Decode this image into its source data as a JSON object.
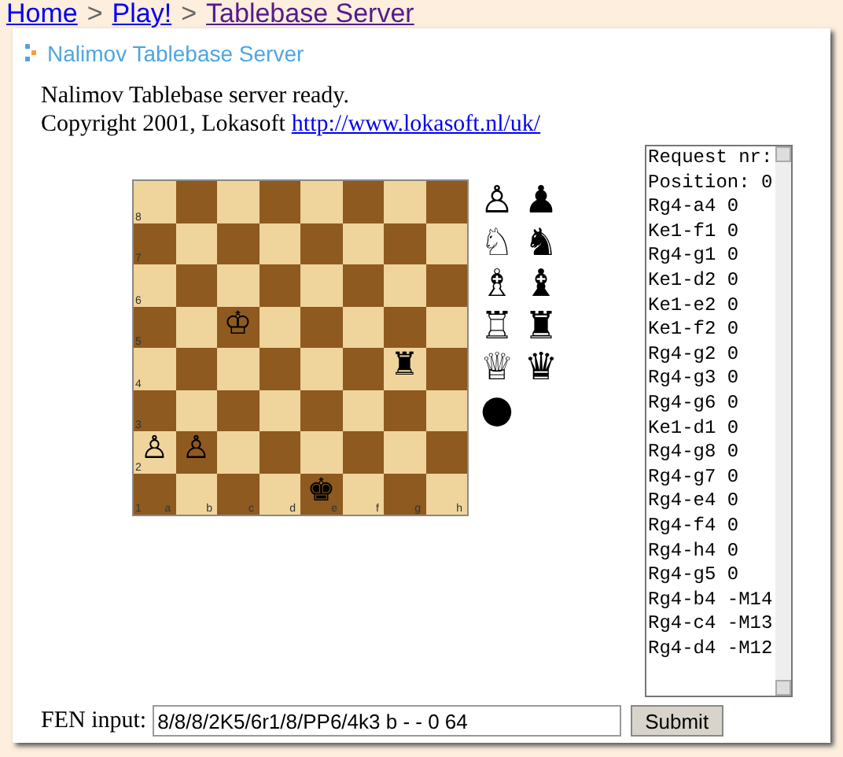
{
  "breadcrumb": [
    {
      "label": "Home",
      "visited": false
    },
    {
      "label": "Play!",
      "visited": false
    },
    {
      "label": "Tablebase Server",
      "visited": true
    }
  ],
  "breadcrumb_separator": ">",
  "heading": "Nalimov Tablebase Server",
  "status_text": "Nalimov Tablebase server ready.",
  "copyright": "Copyright 2001, Lokasoft",
  "link": "http://www.lokasoft.nl/uk/",
  "board": {
    "rank_labels": [
      "8",
      "7",
      "6",
      "5",
      "4",
      "3",
      "2",
      "1"
    ],
    "file_labels": [
      "a",
      "b",
      "c",
      "d",
      "e",
      "f",
      "g",
      "h"
    ],
    "rows": [
      [
        {
          "kind": "light"
        },
        {
          "kind": "dark"
        },
        {
          "kind": "light"
        },
        {
          "kind": "dark"
        },
        {
          "kind": "light"
        },
        {
          "kind": "dark"
        },
        {
          "kind": "light"
        },
        {
          "kind": "dark"
        }
      ],
      [
        {
          "kind": "dark"
        },
        {
          "kind": "light"
        },
        {
          "kind": "dark"
        },
        {
          "kind": "light"
        },
        {
          "kind": "dark"
        },
        {
          "kind": "light"
        },
        {
          "kind": "dark"
        },
        {
          "kind": "light"
        }
      ],
      [
        {
          "kind": "light"
        },
        {
          "kind": "dark"
        },
        {
          "kind": "light"
        },
        {
          "kind": "dark"
        },
        {
          "kind": "light"
        },
        {
          "kind": "dark"
        },
        {
          "kind": "light"
        },
        {
          "kind": "dark"
        }
      ],
      [
        {
          "kind": "dark"
        },
        {
          "kind": "light"
        },
        {
          "kind": "dark",
          "piece": "♔"
        },
        {
          "kind": "light"
        },
        {
          "kind": "dark"
        },
        {
          "kind": "light"
        },
        {
          "kind": "dark"
        },
        {
          "kind": "light"
        }
      ],
      [
        {
          "kind": "light"
        },
        {
          "kind": "dark"
        },
        {
          "kind": "light"
        },
        {
          "kind": "dark"
        },
        {
          "kind": "light"
        },
        {
          "kind": "dark"
        },
        {
          "kind": "light",
          "piece": "♜"
        },
        {
          "kind": "dark"
        }
      ],
      [
        {
          "kind": "dark"
        },
        {
          "kind": "light"
        },
        {
          "kind": "dark"
        },
        {
          "kind": "light"
        },
        {
          "kind": "dark"
        },
        {
          "kind": "light"
        },
        {
          "kind": "dark"
        },
        {
          "kind": "light"
        }
      ],
      [
        {
          "kind": "light",
          "piece": "♙"
        },
        {
          "kind": "dark",
          "piece": "♙"
        },
        {
          "kind": "light"
        },
        {
          "kind": "dark"
        },
        {
          "kind": "light"
        },
        {
          "kind": "dark"
        },
        {
          "kind": "light"
        },
        {
          "kind": "dark"
        }
      ],
      [
        {
          "kind": "dark"
        },
        {
          "kind": "light"
        },
        {
          "kind": "dark"
        },
        {
          "kind": "light"
        },
        {
          "kind": "dark",
          "piece": "♚"
        },
        {
          "kind": "light"
        },
        {
          "kind": "dark"
        },
        {
          "kind": "light"
        }
      ]
    ]
  },
  "palette": [
    [
      "♙",
      "♟"
    ],
    [
      "♘",
      "♞"
    ],
    [
      "♗",
      "♝"
    ],
    [
      "♖",
      "♜"
    ],
    [
      "♕",
      "♛"
    ],
    [
      "●"
    ]
  ],
  "results": [
    "Request nr:",
    "Position: 0",
    "Rg4-a4 0",
    "Ke1-f1 0",
    "Rg4-g1 0",
    "Ke1-d2 0",
    "Ke1-e2 0",
    "Ke1-f2 0",
    "Rg4-g2 0",
    "Rg4-g3 0",
    "Rg4-g6 0",
    "Ke1-d1 0",
    "Rg4-g8 0",
    "Rg4-g7 0",
    "Rg4-e4 0",
    "Rg4-f4 0",
    "Rg4-h4 0",
    "Rg4-g5 0",
    "Rg4-b4 -M14",
    "Rg4-c4 -M13",
    "Rg4-d4 -M12"
  ],
  "fen": {
    "label": "FEN input:",
    "value": "8/8/8/2K5/6r1/8/PP6/4k3 b - - 0 64"
  },
  "submit": "Submit"
}
